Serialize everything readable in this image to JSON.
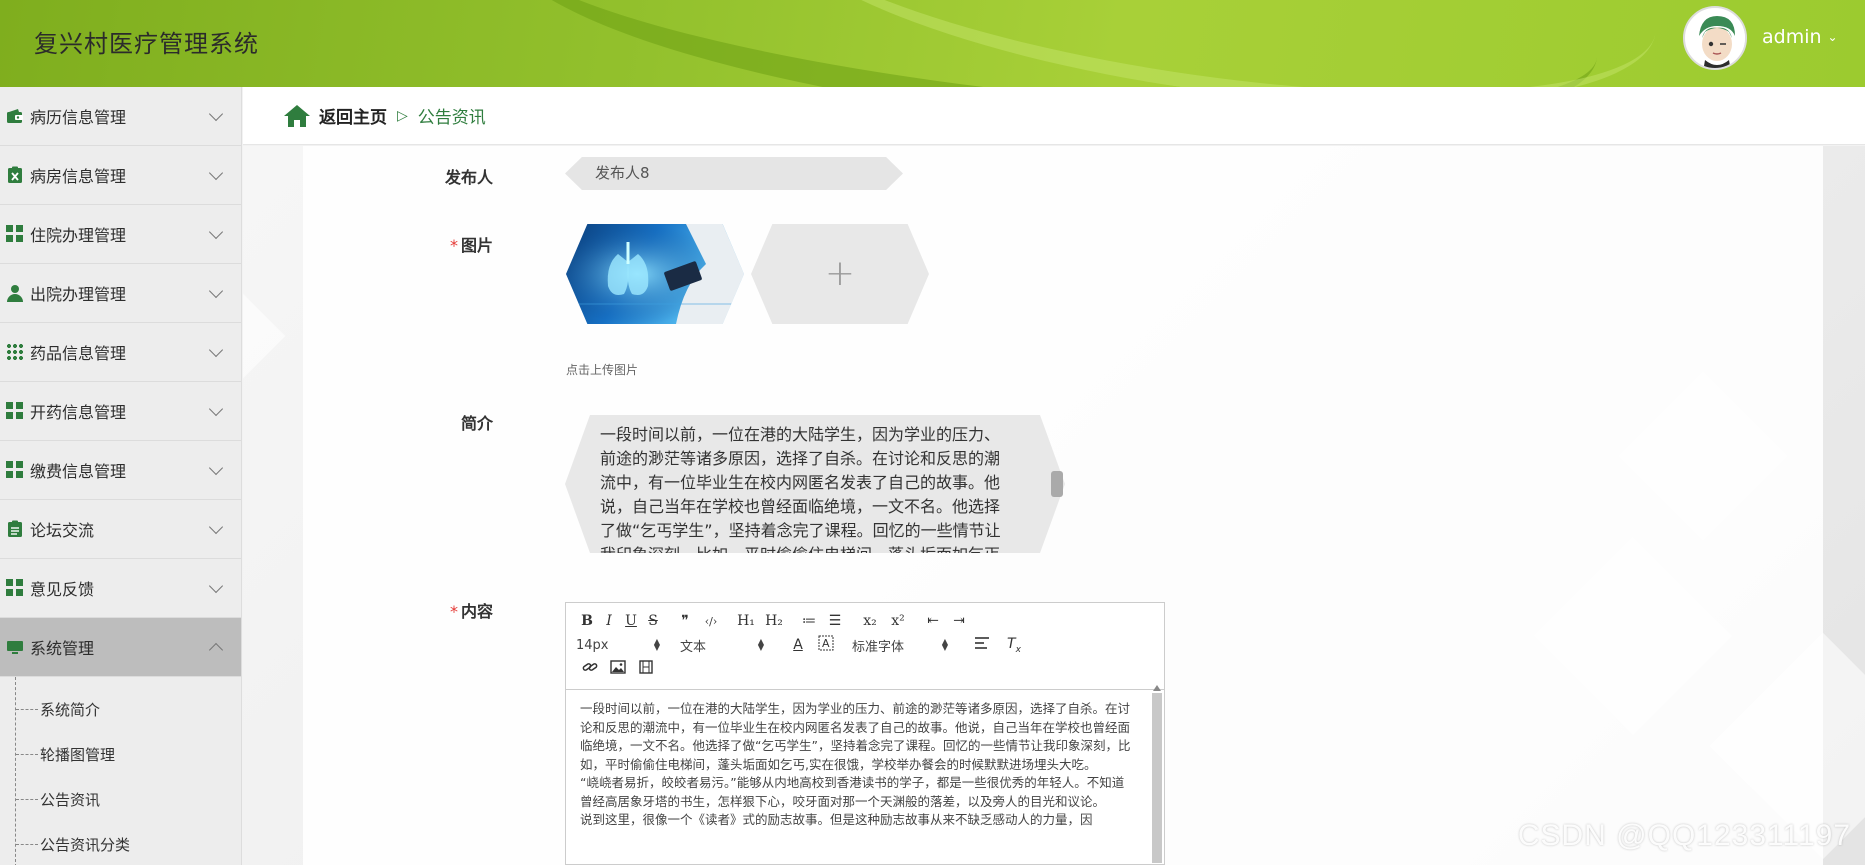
{
  "header": {
    "app_title": "复兴村医疗管理系统",
    "username": "admin"
  },
  "sidebar": {
    "items": [
      {
        "label": "病历信息管理",
        "icon": "wallet-icon"
      },
      {
        "label": "病房信息管理",
        "icon": "clipboard-x-icon"
      },
      {
        "label": "住院办理管理",
        "icon": "grid-icon"
      },
      {
        "label": "出院办理管理",
        "icon": "person-icon"
      },
      {
        "label": "药品信息管理",
        "icon": "dots-grid-icon"
      },
      {
        "label": "开药信息管理",
        "icon": "grid-icon"
      },
      {
        "label": "缴费信息管理",
        "icon": "grid-icon"
      },
      {
        "label": "论坛交流",
        "icon": "clipboard-icon"
      },
      {
        "label": "意见反馈",
        "icon": "grid-icon"
      },
      {
        "label": "系统管理",
        "icon": "monitor-icon",
        "expanded": true
      }
    ],
    "sub_items": [
      "系统简介",
      "轮播图管理",
      "公告资讯",
      "公告资讯分类"
    ]
  },
  "breadcrumb": {
    "home_label": "返回主页",
    "separator": "▷",
    "current": "公告资讯"
  },
  "form": {
    "publisher_label": "发布人",
    "publisher_value": "发布人8",
    "image_label": "图片",
    "upload_tip": "点击上传图片",
    "intro_label": "简介",
    "intro_text": "一段时间以前，一位在港的大陆学生，因为学业的压力、前途的渺茫等诸多原因，选择了自杀。在讨论和反思的潮流中，有一位毕业生在校内网匿名发表了自己的故事。他说，自己当年在学校也曾经面临绝境，一文不名。他选择了做“乞丐学生”，坚持着念完了课程。回忆的一些情节让我印象深刻，比如，平时偷偷住电梯间，蓬头垢面如乞丐",
    "content_label": "内容",
    "required_mark": "*"
  },
  "editor": {
    "font_size": "14px",
    "block_format": "文本",
    "font_family": "标准字体",
    "toolbar_row1": [
      "B",
      "I",
      "U",
      "S",
      "❞",
      "‹/›",
      "H₁",
      "H₂",
      "≔",
      "☰",
      "x₂",
      "x²",
      "⇤",
      "⇥"
    ],
    "paragraphs": [
      "一段时间以前，一位在港的大陆学生，因为学业的压力、前途的渺茫等诸多原因，选择了自杀。在讨论和反思的潮流中，有一位毕业生在校内网匿名发表了自己的故事。他说，自己当年在学校也曾经面临绝境，一文不名。他选择了做“乞丐学生”，坚持着念完了课程。回忆的一些情节让我印象深刻，比如，平时偷偷住电梯间，蓬头垢面如乞丐,实在很饿，学校举办餐会的时候默默进场埋头大吃。",
      "“峣峣者易折，皎皎者易污。”能够从内地高校到香港读书的学子，都是一些很优秀的年轻人。不知道曾经高居象牙塔的书生，怎样狠下心，咬牙面对那一个天渊般的落差，以及旁人的目光和议论。",
      "说到这里，很像一个《读者》式的励志故事。但是这种励志故事从来不缺乏感动人的力量，因"
    ]
  },
  "watermark": "CSDN @QQ123311197",
  "colors": {
    "accent_green": "#2f7d3e",
    "header_green": "#93c12d",
    "required_red": "#e53935"
  }
}
